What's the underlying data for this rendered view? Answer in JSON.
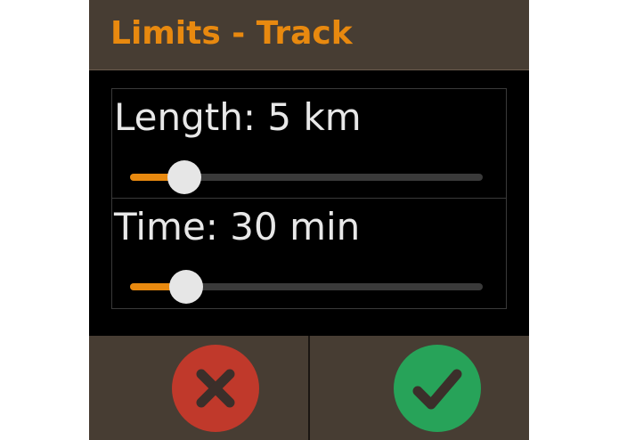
{
  "dialog": {
    "title": "Limits - Track"
  },
  "limits": {
    "length": {
      "label": "Length: 5 km",
      "fraction": 0.155
    },
    "time": {
      "label": "Time: 30 min",
      "fraction": 0.16
    }
  },
  "buttons": {
    "cancel": {
      "icon": "close-icon",
      "color": "#c0392b"
    },
    "ok": {
      "icon": "check-icon",
      "color": "#27a359"
    }
  },
  "colors": {
    "accent": "#e8890f",
    "header_bg": "#473d33",
    "background": "#000000"
  }
}
